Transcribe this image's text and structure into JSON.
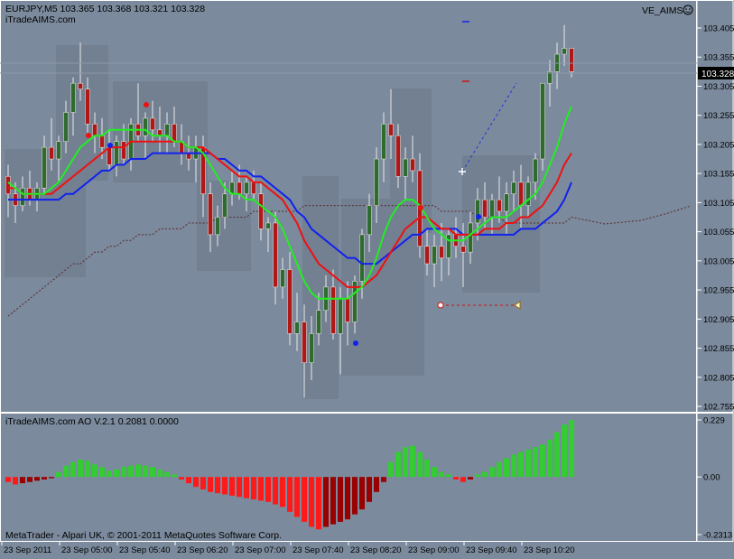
{
  "header": {
    "symbol_line": "EURJPY,M5  103.365 103.368 103.321 103.328",
    "site": "iTradeAIMS.com",
    "indicator_name": "VE_AIMS",
    "indicator_icon": "smiley-icon"
  },
  "subwindow": {
    "title": "iTradeAIMS.com AO V.2.1 0.2081 0.0000"
  },
  "footer": {
    "copyright": "MetaTrader - Alpari UK, © 2001-2011 MetaQuotes Software Corp."
  },
  "colors": {
    "background": "#7b8a9c",
    "grid": "#8e9aab",
    "bull": "#2f6b2f",
    "bear": "#b01818",
    "ma_green": "#22ee22",
    "ma_red": "#ee1111",
    "ma_blue": "#1122ee",
    "ao_up": "#33cc33",
    "ao_down_bright": "#ff1a1a",
    "ao_down_dark": "#990000",
    "session_box": "#6f7c8e"
  },
  "chart_data": [
    {
      "type": "candlestick",
      "title": "EURJPY,M5",
      "price_label": "103.328",
      "ylim": [
        102.745,
        103.44
      ],
      "y_ticks": [
        "103.405",
        "103.355",
        "103.305",
        "103.255",
        "103.205",
        "103.155",
        "103.105",
        "103.055",
        "103.005",
        "102.955",
        "102.905",
        "102.855",
        "102.805",
        "102.755"
      ],
      "x_labels": [
        "23 Sep 2011",
        "23 Sep 05:00",
        "23 Sep 05:40",
        "23 Sep 06:20",
        "23 Sep 07:00",
        "23 Sep 07:40",
        "23 Sep 08:20",
        "23 Sep 09:00",
        "23 Sep 09:40",
        "23 Sep 10:20"
      ],
      "candles": [
        {
          "o": 103.15,
          "h": 103.17,
          "l": 103.08,
          "c": 103.12
        },
        {
          "o": 103.12,
          "h": 103.14,
          "l": 103.07,
          "c": 103.1
        },
        {
          "o": 103.1,
          "h": 103.15,
          "l": 103.09,
          "c": 103.13
        },
        {
          "o": 103.13,
          "h": 103.16,
          "l": 103.1,
          "c": 103.11
        },
        {
          "o": 103.11,
          "h": 103.14,
          "l": 103.09,
          "c": 103.13
        },
        {
          "o": 103.13,
          "h": 103.22,
          "l": 103.12,
          "c": 103.2
        },
        {
          "o": 103.2,
          "h": 103.25,
          "l": 103.16,
          "c": 103.18
        },
        {
          "o": 103.18,
          "h": 103.22,
          "l": 103.14,
          "c": 103.21
        },
        {
          "o": 103.21,
          "h": 103.28,
          "l": 103.19,
          "c": 103.26
        },
        {
          "o": 103.26,
          "h": 103.32,
          "l": 103.22,
          "c": 103.31
        },
        {
          "o": 103.31,
          "h": 103.38,
          "l": 103.28,
          "c": 103.3
        },
        {
          "o": 103.3,
          "h": 103.32,
          "l": 103.22,
          "c": 103.24
        },
        {
          "o": 103.24,
          "h": 103.26,
          "l": 103.19,
          "c": 103.22
        },
        {
          "o": 103.22,
          "h": 103.25,
          "l": 103.18,
          "c": 103.2
        },
        {
          "o": 103.2,
          "h": 103.23,
          "l": 103.16,
          "c": 103.17
        },
        {
          "o": 103.17,
          "h": 103.22,
          "l": 103.15,
          "c": 103.21
        },
        {
          "o": 103.21,
          "h": 103.24,
          "l": 103.17,
          "c": 103.18
        },
        {
          "o": 103.18,
          "h": 103.25,
          "l": 103.16,
          "c": 103.24
        },
        {
          "o": 103.24,
          "h": 103.31,
          "l": 103.21,
          "c": 103.22
        },
        {
          "o": 103.22,
          "h": 103.26,
          "l": 103.18,
          "c": 103.25
        },
        {
          "o": 103.25,
          "h": 103.28,
          "l": 103.21,
          "c": 103.23
        },
        {
          "o": 103.23,
          "h": 103.27,
          "l": 103.19,
          "c": 103.22
        },
        {
          "o": 103.22,
          "h": 103.26,
          "l": 103.19,
          "c": 103.24
        },
        {
          "o": 103.24,
          "h": 103.27,
          "l": 103.2,
          "c": 103.21
        },
        {
          "o": 103.21,
          "h": 103.24,
          "l": 103.17,
          "c": 103.19
        },
        {
          "o": 103.19,
          "h": 103.22,
          "l": 103.16,
          "c": 103.18
        },
        {
          "o": 103.18,
          "h": 103.22,
          "l": 103.14,
          "c": 103.2
        },
        {
          "o": 103.2,
          "h": 103.22,
          "l": 103.08,
          "c": 103.12
        },
        {
          "o": 103.12,
          "h": 103.14,
          "l": 103.02,
          "c": 103.05
        },
        {
          "o": 103.05,
          "h": 103.1,
          "l": 103.03,
          "c": 103.08
        },
        {
          "o": 103.08,
          "h": 103.14,
          "l": 103.06,
          "c": 103.12
        },
        {
          "o": 103.12,
          "h": 103.16,
          "l": 103.1,
          "c": 103.14
        },
        {
          "o": 103.14,
          "h": 103.17,
          "l": 103.11,
          "c": 103.12
        },
        {
          "o": 103.12,
          "h": 103.15,
          "l": 103.09,
          "c": 103.14
        },
        {
          "o": 103.14,
          "h": 103.16,
          "l": 103.11,
          "c": 103.12
        },
        {
          "o": 103.12,
          "h": 103.14,
          "l": 103.04,
          "c": 103.06
        },
        {
          "o": 103.06,
          "h": 103.08,
          "l": 103.02,
          "c": 103.07
        },
        {
          "o": 103.07,
          "h": 103.09,
          "l": 102.93,
          "c": 102.96
        },
        {
          "o": 102.96,
          "h": 103.01,
          "l": 102.94,
          "c": 102.99
        },
        {
          "o": 102.99,
          "h": 103.02,
          "l": 102.86,
          "c": 102.88
        },
        {
          "o": 102.88,
          "h": 102.95,
          "l": 102.85,
          "c": 102.9
        },
        {
          "o": 102.9,
          "h": 102.93,
          "l": 102.77,
          "c": 102.83
        },
        {
          "o": 102.83,
          "h": 102.91,
          "l": 102.8,
          "c": 102.88
        },
        {
          "o": 102.88,
          "h": 102.95,
          "l": 102.86,
          "c": 102.92
        },
        {
          "o": 102.92,
          "h": 102.98,
          "l": 102.9,
          "c": 102.96
        },
        {
          "o": 102.96,
          "h": 102.99,
          "l": 102.87,
          "c": 102.88
        },
        {
          "o": 102.88,
          "h": 102.96,
          "l": 102.81,
          "c": 102.94
        },
        {
          "o": 102.94,
          "h": 102.97,
          "l": 102.86,
          "c": 102.9
        },
        {
          "o": 102.9,
          "h": 102.98,
          "l": 102.88,
          "c": 102.97
        },
        {
          "o": 102.97,
          "h": 103.06,
          "l": 102.94,
          "c": 103.05
        },
        {
          "o": 103.05,
          "h": 103.12,
          "l": 103.02,
          "c": 103.1
        },
        {
          "o": 103.1,
          "h": 103.2,
          "l": 103.07,
          "c": 103.18
        },
        {
          "o": 103.18,
          "h": 103.26,
          "l": 103.14,
          "c": 103.24
        },
        {
          "o": 103.24,
          "h": 103.3,
          "l": 103.18,
          "c": 103.22
        },
        {
          "o": 103.22,
          "h": 103.24,
          "l": 103.13,
          "c": 103.15
        },
        {
          "o": 103.15,
          "h": 103.2,
          "l": 103.11,
          "c": 103.18
        },
        {
          "o": 103.18,
          "h": 103.22,
          "l": 103.14,
          "c": 103.16
        },
        {
          "o": 103.16,
          "h": 103.19,
          "l": 103.01,
          "c": 103.03
        },
        {
          "o": 103.03,
          "h": 103.06,
          "l": 102.98,
          "c": 103.0
        },
        {
          "o": 103.0,
          "h": 103.05,
          "l": 102.96,
          "c": 103.03
        },
        {
          "o": 103.03,
          "h": 103.07,
          "l": 102.97,
          "c": 103.01
        },
        {
          "o": 103.01,
          "h": 103.06,
          "l": 102.98,
          "c": 103.05
        },
        {
          "o": 103.05,
          "h": 103.08,
          "l": 103.01,
          "c": 103.03
        },
        {
          "o": 103.03,
          "h": 103.07,
          "l": 102.96,
          "c": 103.02
        },
        {
          "o": 103.02,
          "h": 103.09,
          "l": 103.0,
          "c": 103.07
        },
        {
          "o": 103.07,
          "h": 103.13,
          "l": 103.04,
          "c": 103.11
        },
        {
          "o": 103.11,
          "h": 103.14,
          "l": 103.06,
          "c": 103.08
        },
        {
          "o": 103.08,
          "h": 103.12,
          "l": 103.05,
          "c": 103.11
        },
        {
          "o": 103.11,
          "h": 103.15,
          "l": 103.07,
          "c": 103.09
        },
        {
          "o": 103.09,
          "h": 103.14,
          "l": 103.05,
          "c": 103.12
        },
        {
          "o": 103.12,
          "h": 103.16,
          "l": 103.09,
          "c": 103.14
        },
        {
          "o": 103.14,
          "h": 103.17,
          "l": 103.06,
          "c": 103.1
        },
        {
          "o": 103.1,
          "h": 103.15,
          "l": 103.08,
          "c": 103.14
        },
        {
          "o": 103.14,
          "h": 103.19,
          "l": 103.11,
          "c": 103.18
        },
        {
          "o": 103.18,
          "h": 103.25,
          "l": 103.16,
          "c": 103.31
        },
        {
          "o": 103.31,
          "h": 103.35,
          "l": 103.27,
          "c": 103.33
        },
        {
          "o": 103.33,
          "h": 103.38,
          "l": 103.3,
          "c": 103.36
        },
        {
          "o": 103.36,
          "h": 103.41,
          "l": 103.34,
          "c": 103.37
        },
        {
          "o": 103.37,
          "h": 103.37,
          "l": 103.32,
          "c": 103.33
        }
      ],
      "ma_green": [
        103.14,
        103.13,
        103.12,
        103.12,
        103.12,
        103.12,
        103.13,
        103.14,
        103.16,
        103.18,
        103.2,
        103.21,
        103.22,
        103.22,
        103.23,
        103.23,
        103.23,
        103.23,
        103.23,
        103.23,
        103.22,
        103.22,
        103.22,
        103.21,
        103.21,
        103.2,
        103.2,
        103.19,
        103.17,
        103.15,
        103.13,
        103.12,
        103.12,
        103.11,
        103.11,
        103.1,
        103.09,
        103.08,
        103.06,
        103.03,
        103.0,
        102.97,
        102.95,
        102.94,
        102.94,
        102.94,
        102.94,
        102.94,
        102.95,
        102.96,
        102.98,
        103.01,
        103.05,
        103.08,
        103.1,
        103.11,
        103.11,
        103.1,
        103.08,
        103.06,
        103.05,
        103.04,
        103.04,
        103.04,
        103.05,
        103.06,
        103.07,
        103.08,
        103.08,
        103.08,
        103.09,
        103.1,
        103.11,
        103.12,
        103.14,
        103.17,
        103.2,
        103.24,
        103.27
      ],
      "ma_red": [
        103.13,
        103.13,
        103.12,
        103.12,
        103.12,
        103.12,
        103.12,
        103.13,
        103.14,
        103.15,
        103.16,
        103.17,
        103.18,
        103.19,
        103.2,
        103.2,
        103.2,
        103.21,
        103.21,
        103.21,
        103.21,
        103.21,
        103.21,
        103.21,
        103.21,
        103.2,
        103.2,
        103.2,
        103.19,
        103.18,
        103.17,
        103.16,
        103.15,
        103.15,
        103.14,
        103.14,
        103.13,
        103.12,
        103.11,
        103.09,
        103.07,
        103.04,
        103.02,
        103.0,
        102.99,
        102.98,
        102.97,
        102.96,
        102.96,
        102.96,
        102.97,
        102.98,
        103.0,
        103.02,
        103.04,
        103.06,
        103.07,
        103.08,
        103.08,
        103.07,
        103.06,
        103.06,
        103.05,
        103.05,
        103.05,
        103.05,
        103.06,
        103.06,
        103.06,
        103.07,
        103.07,
        103.08,
        103.08,
        103.09,
        103.1,
        103.12,
        103.14,
        103.17,
        103.19
      ],
      "ma_blue": [
        103.11,
        103.11,
        103.11,
        103.11,
        103.11,
        103.11,
        103.11,
        103.11,
        103.12,
        103.12,
        103.13,
        103.14,
        103.15,
        103.16,
        103.16,
        103.17,
        103.17,
        103.18,
        103.18,
        103.18,
        103.19,
        103.19,
        103.19,
        103.19,
        103.19,
        103.19,
        103.19,
        103.19,
        103.19,
        103.18,
        103.18,
        103.17,
        103.16,
        103.16,
        103.15,
        103.15,
        103.14,
        103.13,
        103.12,
        103.11,
        103.09,
        103.08,
        103.06,
        103.05,
        103.04,
        103.03,
        103.02,
        103.01,
        103.01,
        103.0,
        103.0,
        103.0,
        103.01,
        103.02,
        103.03,
        103.04,
        103.05,
        103.05,
        103.06,
        103.06,
        103.06,
        103.06,
        103.06,
        103.05,
        103.05,
        103.05,
        103.05,
        103.05,
        103.05,
        103.05,
        103.05,
        103.06,
        103.06,
        103.06,
        103.07,
        103.08,
        103.09,
        103.11,
        103.14
      ],
      "ma_dotted": [
        102.91,
        102.92,
        102.93,
        102.94,
        102.95,
        102.96,
        102.97,
        102.98,
        102.99,
        103.0,
        103.0,
        103.01,
        103.02,
        103.02,
        103.03,
        103.03,
        103.04,
        103.04,
        103.05,
        103.05,
        103.05,
        103.06,
        103.06,
        103.06,
        103.06,
        103.07,
        103.07,
        103.07,
        103.07,
        103.08,
        103.08,
        103.08,
        103.08,
        103.08,
        103.09,
        103.09,
        103.09,
        103.09,
        103.09,
        103.09,
        103.09,
        103.1,
        103.1,
        103.1,
        103.1,
        103.1,
        103.1,
        103.1,
        103.1,
        103.1,
        103.1,
        103.1,
        103.1,
        103.1,
        103.1,
        103.1,
        103.1,
        103.1,
        103.1,
        103.1,
        103.09,
        103.09,
        103.09,
        103.09,
        103.09,
        103.08,
        103.08,
        103.08,
        103.08,
        103.07,
        103.07,
        103.07,
        103.07,
        103.07,
        103.07,
        103.07,
        103.07,
        103.07,
        103.08
      ]
    },
    {
      "type": "bar",
      "title": "iTradeAIMS.com AO V.2.1",
      "y_ticks": [
        "0.229",
        "0.00",
        "-0.2313"
      ],
      "ylim": [
        -0.2313,
        0.229
      ],
      "values": [
        -0.02,
        -0.03,
        -0.025,
        -0.02,
        -0.015,
        -0.01,
        -0.005,
        0.02,
        0.045,
        0.06,
        0.07,
        0.065,
        0.05,
        0.04,
        0.025,
        0.03,
        0.04,
        0.045,
        0.05,
        0.045,
        0.04,
        0.03,
        0.02,
        0.01,
        -0.01,
        -0.025,
        -0.04,
        -0.05,
        -0.06,
        -0.065,
        -0.07,
        -0.075,
        -0.08,
        -0.085,
        -0.09,
        -0.095,
        -0.1,
        -0.11,
        -0.12,
        -0.14,
        -0.16,
        -0.18,
        -0.2,
        -0.21,
        -0.2,
        -0.19,
        -0.18,
        -0.17,
        -0.15,
        -0.13,
        -0.1,
        -0.06,
        -0.02,
        0.06,
        0.1,
        0.12,
        0.125,
        0.1,
        0.07,
        0.04,
        0.02,
        0.01,
        -0.01,
        -0.02,
        -0.01,
        0.01,
        0.02,
        0.04,
        0.06,
        0.075,
        0.09,
        0.1,
        0.11,
        0.12,
        0.13,
        0.15,
        0.18,
        0.21,
        0.229
      ]
    }
  ]
}
